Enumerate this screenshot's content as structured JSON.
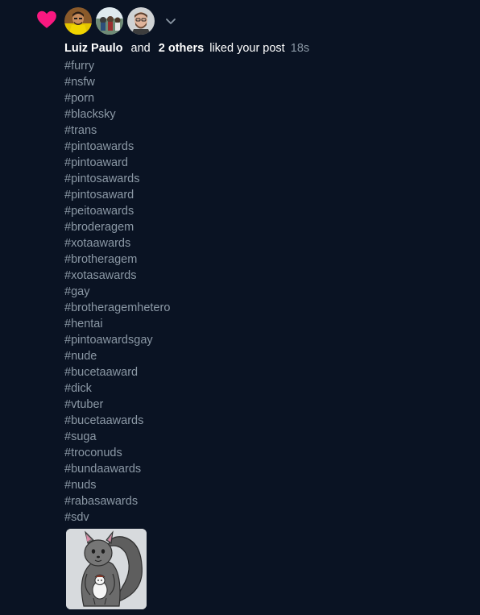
{
  "notification": {
    "liker_name": "Luiz Paulo",
    "conjunction": "and",
    "others_count": "2 others",
    "action_text": "liked your post",
    "timestamp": "18s",
    "icon": "heart-icon",
    "accent_color": "#f91880",
    "avatars": [
      {
        "icon": "avatar-yellow-shirt"
      },
      {
        "icon": "avatar-outdoor-group"
      },
      {
        "icon": "avatar-bearded-man"
      }
    ]
  },
  "post": {
    "hashtags": [
      "#furry",
      "#nsfw",
      "#porn",
      "#blacksky",
      "#trans",
      "#pintoawards",
      "#pintoaward",
      "#pintosawards",
      "#pintosaward",
      "#peitoawards",
      "#broderagem",
      "#xotaawards",
      "#brotheragem",
      "#xotasawards",
      "#gay",
      "#brotheragemhetero",
      "#hentai",
      "#pintoawardsgay",
      "#nude",
      "#bucetaaward",
      "#dick",
      "#vtuber",
      "#bucetaawards",
      "#suga",
      "#troconuds",
      "#bundaawards",
      "#nuds",
      "#rabasawards",
      "#sdv"
    ],
    "media": {
      "icon": "squirrel-drawing-thumbnail"
    }
  }
}
